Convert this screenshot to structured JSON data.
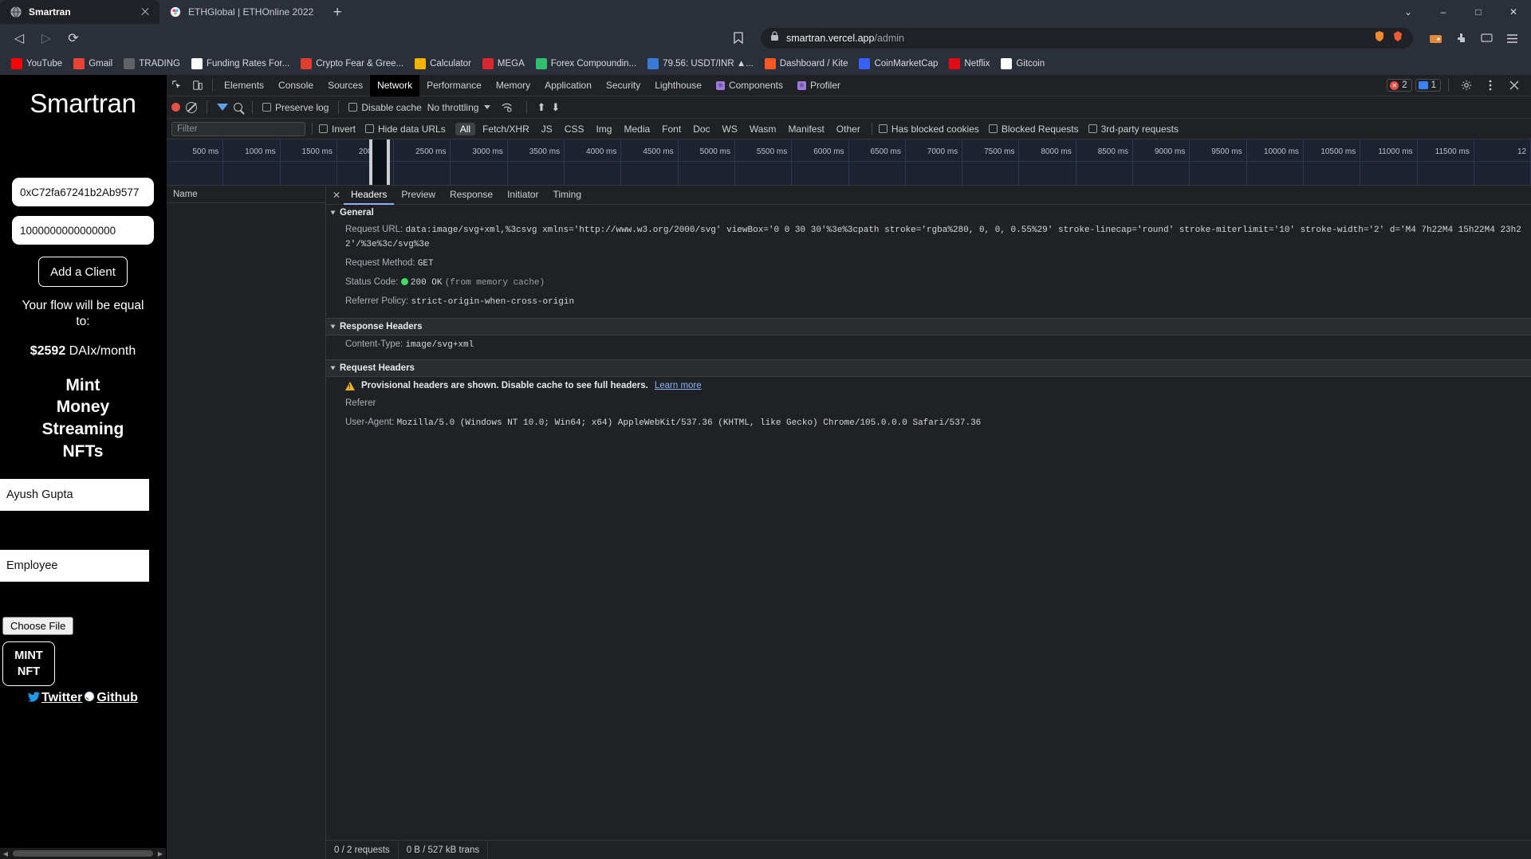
{
  "browser": {
    "tabs": [
      {
        "title": "Smartran",
        "favicon": "globe-icon",
        "active": true
      },
      {
        "title": "ETHGlobal | ETHOnline 2022",
        "favicon": "ethglobal-icon",
        "active": false
      }
    ],
    "new_tab_label": "+",
    "window_controls": {
      "minimize": "–",
      "restore": "□",
      "close": "✕",
      "expand": "⌄"
    },
    "nav": {
      "back": "◁",
      "forward": "▷",
      "reload": "⟳",
      "bookmark": "☐"
    },
    "omnibox": {
      "lock_icon": "lock-icon",
      "host": "smartran.vercel.app",
      "path": "/admin",
      "full_url": "smartran.vercel.app/admin",
      "brave_shield_icon": "shield-icon",
      "brave_lion_icon": "brave-icon"
    },
    "toolbar_right": {
      "extension_icon": "puzzle-icon",
      "wallet_icon": "wallet-icon",
      "cast_icon": "cast-icon",
      "menu_icon": "hamburger-menu-icon"
    },
    "bookmarks": [
      {
        "label": "YouTube",
        "icon": "youtube-icon",
        "color": "#ff0000"
      },
      {
        "label": "Gmail",
        "icon": "gmail-icon",
        "color": "#ea4335"
      },
      {
        "label": "TRADING",
        "icon": "trading-icon",
        "color": "#5f6368"
      },
      {
        "label": "Funding Rates For...",
        "icon": "funding-icon",
        "color": "#ffffff"
      },
      {
        "label": "Crypto Fear & Gree...",
        "icon": "crypto-fear-icon",
        "color": "#e03b2f"
      },
      {
        "label": "Calculator",
        "icon": "calculator-icon",
        "color": "#f5b301"
      },
      {
        "label": "MEGA",
        "icon": "mega-icon",
        "color": "#d9272e"
      },
      {
        "label": "Forex Compoundin...",
        "icon": "forex-icon",
        "color": "#2fbf71"
      },
      {
        "label": "79.56: USDT/INR ▲...",
        "icon": "usdt-icon",
        "color": "#3a7bd5"
      },
      {
        "label": "Dashboard / Kite",
        "icon": "kite-icon",
        "color": "#ff5722"
      },
      {
        "label": "CoinMarketCap",
        "icon": "coinmarketcap-icon",
        "color": "#3861fb"
      },
      {
        "label": "Netflix",
        "icon": "netflix-icon",
        "color": "#e50914"
      },
      {
        "label": "Gitcoin",
        "icon": "gitcoin-icon",
        "color": "#ffffff"
      }
    ]
  },
  "app": {
    "title": "Smartran",
    "address_value": "0xC72fa67241b2Ab9577",
    "amount_value": "1000000000000000",
    "add_client_button": "Add a Client",
    "flow_note_line1": "Your flow will be equal",
    "flow_note_line2": "to:",
    "flow_amount": "$2592",
    "flow_unit": " DAIx/month",
    "headline_lines": [
      "Mint",
      "Money",
      "Streaming",
      "NFTs"
    ],
    "name_value": "Ayush Gupta",
    "role_value": "Employee",
    "choose_file_label": "Choose File",
    "mint_nft_line1": "MINT",
    "mint_nft_line2": "NFT",
    "twitter_label": "Twitter",
    "github_label": "Github"
  },
  "devtools": {
    "panel_tabs": [
      {
        "label": "Elements",
        "active": false,
        "react": false
      },
      {
        "label": "Console",
        "active": false,
        "react": false
      },
      {
        "label": "Sources",
        "active": false,
        "react": false
      },
      {
        "label": "Network",
        "active": true,
        "react": false
      },
      {
        "label": "Performance",
        "active": false,
        "react": false
      },
      {
        "label": "Memory",
        "active": false,
        "react": false
      },
      {
        "label": "Application",
        "active": false,
        "react": false
      },
      {
        "label": "Security",
        "active": false,
        "react": false
      },
      {
        "label": "Lighthouse",
        "active": false,
        "react": false
      },
      {
        "label": "Components",
        "active": false,
        "react": true
      },
      {
        "label": "Profiler",
        "active": false,
        "react": true
      }
    ],
    "badges": {
      "errors": "2",
      "messages": "1"
    },
    "icons": {
      "inspect": "inspect-element-icon",
      "device": "device-toolbar-icon",
      "settings": "gear-icon",
      "more": "kebab-menu-icon",
      "close": "close-icon",
      "record": "record-button-icon",
      "clear": "clear-icon",
      "filter": "filter-funnel-icon",
      "search": "search-icon",
      "wifi": "network-conditions-icon",
      "import": "import-har-icon",
      "export": "export-har-icon"
    },
    "toolbar": {
      "preserve_log": "Preserve log",
      "disable_cache": "Disable cache",
      "throttling": "No throttling"
    },
    "filterbar": {
      "filter_placeholder": "Filter",
      "invert": "Invert",
      "hide_data_urls": "Hide data URLs",
      "types": [
        "All",
        "Fetch/XHR",
        "JS",
        "CSS",
        "Img",
        "Media",
        "Font",
        "Doc",
        "WS",
        "Wasm",
        "Manifest",
        "Other"
      ],
      "active_type": "All",
      "has_blocked_cookies": "Has blocked cookies",
      "blocked_requests": "Blocked Requests",
      "third_party_requests": "3rd-party requests"
    },
    "overview_ticks": [
      "500 ms",
      "1000 ms",
      "1500 ms",
      "2000 ms",
      "2500 ms",
      "3000 ms",
      "3500 ms",
      "4000 ms",
      "4500 ms",
      "5000 ms",
      "5500 ms",
      "6000 ms",
      "6500 ms",
      "7000 ms",
      "7500 ms",
      "8000 ms",
      "8500 ms",
      "9000 ms",
      "9500 ms",
      "10000 ms",
      "10500 ms",
      "11000 ms",
      "11500 ms",
      "12"
    ],
    "request_list_header": "Name",
    "detail_tabs": [
      {
        "label": "Headers",
        "active": true
      },
      {
        "label": "Preview",
        "active": false
      },
      {
        "label": "Response",
        "active": false
      },
      {
        "label": "Initiator",
        "active": false
      },
      {
        "label": "Timing",
        "active": false
      }
    ],
    "headers": {
      "general_title": "General",
      "request_url_key": "Request URL:",
      "request_url_value": "data:image/svg+xml,%3csvg xmlns='http://www.w3.org/2000/svg' viewBox='0 0 30 30'%3e%3cpath stroke='rgba%280, 0, 0, 0.55%29' stroke-linecap='round' stroke-miterlimit='10' stroke-width='2' d='M4 7h22M4 15h22M4 23h22'/%3e%3c/svg%3e",
      "request_method_key": "Request Method:",
      "request_method_value": "GET",
      "status_code_key": "Status Code:",
      "status_code_value": "200 OK",
      "status_code_note": "(from memory cache)",
      "referrer_policy_key": "Referrer Policy:",
      "referrer_policy_value": "strict-origin-when-cross-origin",
      "response_headers_title": "Response Headers",
      "content_type_key": "Content-Type:",
      "content_type_value": "image/svg+xml",
      "request_headers_title": "Request Headers",
      "provisional_warning": "Provisional headers are shown. Disable cache to see full headers.",
      "learn_more": "Learn more",
      "referer_key": "Referer",
      "user_agent_key": "User-Agent:",
      "user_agent_value": "Mozilla/5.0 (Windows NT 10.0; Win64; x64) AppleWebKit/537.36 (KHTML, like Gecko) Chrome/105.0.0.0 Safari/537.36"
    },
    "status_bar": {
      "requests": "0 / 2 requests",
      "transferred": "0 B / 527 kB trans"
    }
  }
}
